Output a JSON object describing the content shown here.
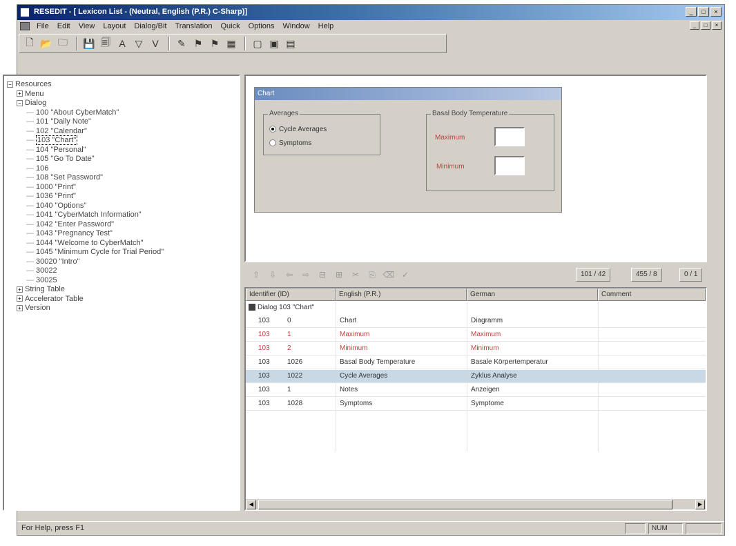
{
  "window": {
    "title": "RESEDIT - [ Lexicon List - (Neutral, English (P.R.) C-Sharp)]",
    "buttons": [
      "_",
      "□",
      "×"
    ],
    "mdi_buttons": [
      "_",
      "□",
      "×"
    ]
  },
  "menu": {
    "items": [
      "File",
      "Edit",
      "View",
      "Layout",
      "Dialog/Bit",
      "Translation",
      "Quick",
      "Options",
      "Window",
      "Help"
    ]
  },
  "toolbar": {
    "icons": [
      "new-icon",
      "open-icon",
      "folder-icon",
      "save-icon",
      "save-all-icon",
      "find-icon",
      "filter-icon",
      "check-icon",
      "tag-icon",
      "flag-icon",
      "flag2-icon",
      "grid-icon",
      "dialog-icon",
      "dialog2-icon",
      "dialog3-icon"
    ],
    "glyphs": [
      "🗋",
      "📂",
      "🗀",
      "💾",
      "🗐",
      "A",
      "▽",
      "V",
      "✎",
      "⚑",
      "⚑",
      "▦",
      "▢",
      "▣",
      "▤"
    ]
  },
  "tree": {
    "rows": [
      {
        "indent": 0,
        "exp": "−",
        "label": "Resources"
      },
      {
        "indent": 1,
        "exp": "+",
        "label": "Menu"
      },
      {
        "indent": 1,
        "exp": "−",
        "label": "Dialog"
      },
      {
        "indent": 2,
        "exp": "",
        "label": "100 \"About CyberMatch\""
      },
      {
        "indent": 2,
        "exp": "",
        "label": "101 \"Daily Note\""
      },
      {
        "indent": 2,
        "exp": "",
        "label": "102 \"Calendar\""
      },
      {
        "indent": 2,
        "exp": "",
        "label": "103 \"Chart\"",
        "selected": true
      },
      {
        "indent": 2,
        "exp": "",
        "label": "104 \"Personal\""
      },
      {
        "indent": 2,
        "exp": "",
        "label": "105 \"Go To Date\""
      },
      {
        "indent": 2,
        "exp": "",
        "label": "106"
      },
      {
        "indent": 2,
        "exp": "",
        "label": "108 \"Set Password\""
      },
      {
        "indent": 2,
        "exp": "",
        "label": "1000 \"Print\""
      },
      {
        "indent": 2,
        "exp": "",
        "label": "1036 \"Print\""
      },
      {
        "indent": 2,
        "exp": "",
        "label": "1040 \"Options\""
      },
      {
        "indent": 2,
        "exp": "",
        "label": "1041 \"CyberMatch Information\""
      },
      {
        "indent": 2,
        "exp": "",
        "label": "1042 \"Enter Password\""
      },
      {
        "indent": 2,
        "exp": "",
        "label": "1043 \"Pregnancy Test\""
      },
      {
        "indent": 2,
        "exp": "",
        "label": "1044 \"Welcome to CyberMatch\""
      },
      {
        "indent": 2,
        "exp": "",
        "label": "1045 \"Minimum Cycle for Trial Period\""
      },
      {
        "indent": 2,
        "exp": "",
        "label": "30020 \"Intro\""
      },
      {
        "indent": 2,
        "exp": "",
        "label": "30022"
      },
      {
        "indent": 2,
        "exp": "",
        "label": "30025"
      },
      {
        "indent": 1,
        "exp": "+",
        "label": "String Table"
      },
      {
        "indent": 1,
        "exp": "+",
        "label": "Accelerator Table"
      },
      {
        "indent": 1,
        "exp": "+",
        "label": "Version"
      }
    ]
  },
  "dialog_preview": {
    "title": "Chart",
    "group_left_label": "Averages",
    "radio1": "Cycle Averages",
    "radio2": "Symptoms",
    "group_right_label": "Basal Body Temperature",
    "field1_label": "Maximum",
    "field2_label": "Minimum"
  },
  "grid_toolbar": {
    "glyphs": [
      "⇧",
      "⇩",
      "⇦",
      "⇨",
      "⊟",
      "⊞",
      "✂",
      "⎘",
      "⌫",
      "✓"
    ],
    "right_buttons": [
      "101 / 42",
      "455 / 8",
      "0 / 1"
    ]
  },
  "grid": {
    "headers": [
      "Identifier (ID)",
      "English (P.R.)",
      "German",
      "Comment"
    ],
    "group_label": "Dialog 103 \"Chart\"",
    "rows": [
      {
        "c0": "103",
        "c1": "0",
        "english": "Chart",
        "german": "Diagramm",
        "color": "#333"
      },
      {
        "c0": "103",
        "c1": "1",
        "english": "Maximum",
        "german": "Maximum",
        "color": "#c04040"
      },
      {
        "c0": "103",
        "c1": "2",
        "english": "Minimum",
        "german": "Minimum",
        "color": "#c04040"
      },
      {
        "c0": "103",
        "c1": "1026",
        "english": "Basal Body Temperature",
        "german": "Basale Körpertemperatur",
        "color": "#333"
      },
      {
        "c0": "103",
        "c1": "1022",
        "english": "Cycle Averages",
        "german": "Zyklus Analyse",
        "color": "#333",
        "hl": true
      },
      {
        "c0": "103",
        "c1": "1",
        "english": "Notes",
        "german": "Anzeigen",
        "color": "#333"
      },
      {
        "c0": "103",
        "c1": "1028",
        "english": "Symptoms",
        "german": "Symptome",
        "color": "#333"
      }
    ]
  },
  "status": {
    "text": "For Help, press F1",
    "panel": "NUM"
  }
}
